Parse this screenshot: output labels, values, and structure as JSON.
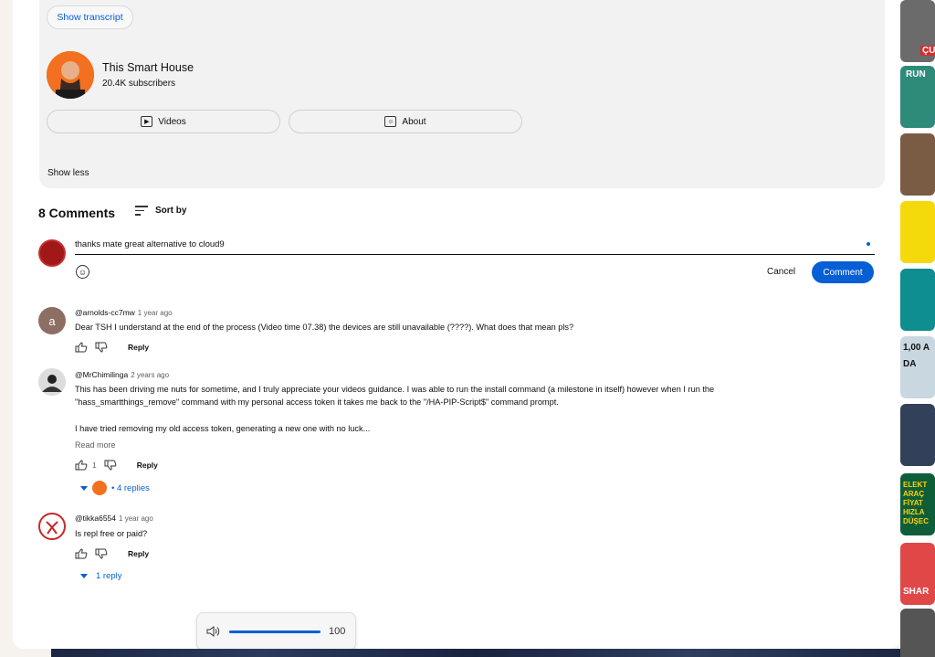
{
  "description": {
    "show_transcript": "Show transcript",
    "channel_name": "This Smart House",
    "subscribers": "20.4K subscribers",
    "videos_label": "Videos",
    "about_label": "About",
    "show_less": "Show less"
  },
  "comments": {
    "count_label": "8 Comments",
    "sort_label": "Sort by",
    "input_value": "thanks mate great alternative to cloud9",
    "cancel_label": "Cancel",
    "submit_label": "Comment",
    "list": [
      {
        "avatar_letter": "a",
        "author": "@arnolds-cc7mw",
        "time": "1 year ago",
        "text": "Dear TSH I understand at the end of the process (Video time 07.38) the devices are still unavailable (????). What does that mean pls?",
        "likes": "",
        "reply": "Reply"
      },
      {
        "author": "@MrChimilinga",
        "time": "2 years ago",
        "text_line1": "This has been driving me nuts for sometime, and I truly appreciate your videos guidance. I was able to run the install command (a milestone in itself) however when I run the",
        "text_line2": "\"hass_smartthings_remove\" command with my personal access token it takes me back to the \"/HA-PIP-Script$\" command prompt.",
        "text_line3": "I have tried removing my old access token, generating a new one with no luck...",
        "read_more": "Read more",
        "likes": "1",
        "reply": "Reply",
        "replies": "• 4 replies"
      },
      {
        "author": "@tikka6554",
        "time": "1 year ago",
        "text": "Is repl free or paid?",
        "likes": "",
        "reply": "Reply",
        "replies": "1 reply"
      }
    ]
  },
  "volume": {
    "value": "100",
    "level_percent": 100
  },
  "sidebar_thumbnails": [
    "ÇU",
    "RUN",
    "",
    "",
    "",
    "1,00 A DA",
    "",
    "ELEKT ARAÇ FİYAT HIZLA DÜŞEC",
    "SHAR",
    ""
  ],
  "colors": {
    "accent": "#065fd4",
    "channel_avatar": "#f37021"
  }
}
